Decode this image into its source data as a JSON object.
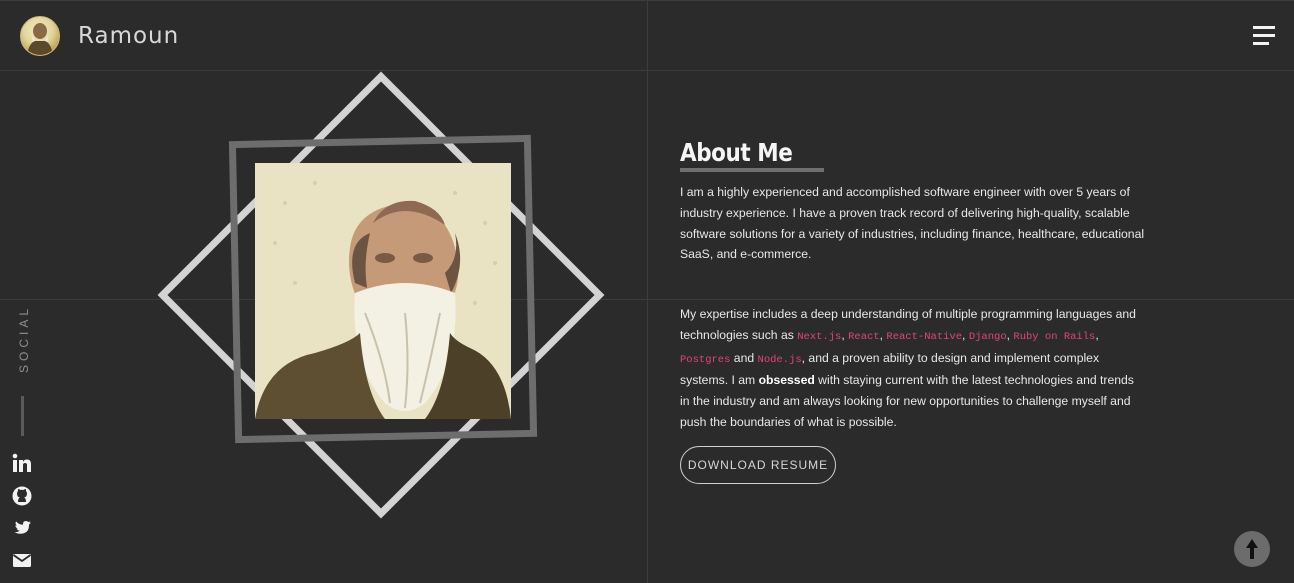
{
  "header": {
    "brand": "Ramoun",
    "avatar_icon": "portrait-avatar-icon",
    "menu_icon": "hamburger-menu-icon"
  },
  "social": {
    "label": "SOCIAL",
    "items": [
      {
        "name": "linkedin-icon"
      },
      {
        "name": "github-icon"
      },
      {
        "name": "twitter-icon"
      },
      {
        "name": "email-icon"
      }
    ]
  },
  "about": {
    "title": "About Me",
    "p1": "I am a highly experienced and accomplished software engineer with over 5 years of industry experience. I have a proven track record of delivering high-quality, scalable software solutions for a variety of industries, including finance, healthcare, educational SaaS, and e-commerce.",
    "p2": {
      "intro": "My expertise includes a deep understanding of multiple programming languages and technologies such as ",
      "tech": [
        "Next.js",
        "React",
        "React-Native",
        "Django",
        "Ruby on Rails",
        "Postgres",
        "Node.js"
      ],
      "sep1": ", ",
      "and": " and ",
      "after_tech": ", and a proven ability to design and implement complex systems. I am ",
      "bold": "obsessed",
      "outro": " with staying current with the latest technologies and trends in the industry and am always looking for new opportunities to challenge myself and push the boundaries of what is possible."
    },
    "resume_button": "DOWNLOAD RESUME"
  },
  "colors": {
    "background": "#2b2b2b",
    "code_accent": "#e0447f",
    "diamond": "#d3d3d3",
    "frame": "#6d6d6d"
  },
  "scroll_top_icon": "arrow-up-icon"
}
